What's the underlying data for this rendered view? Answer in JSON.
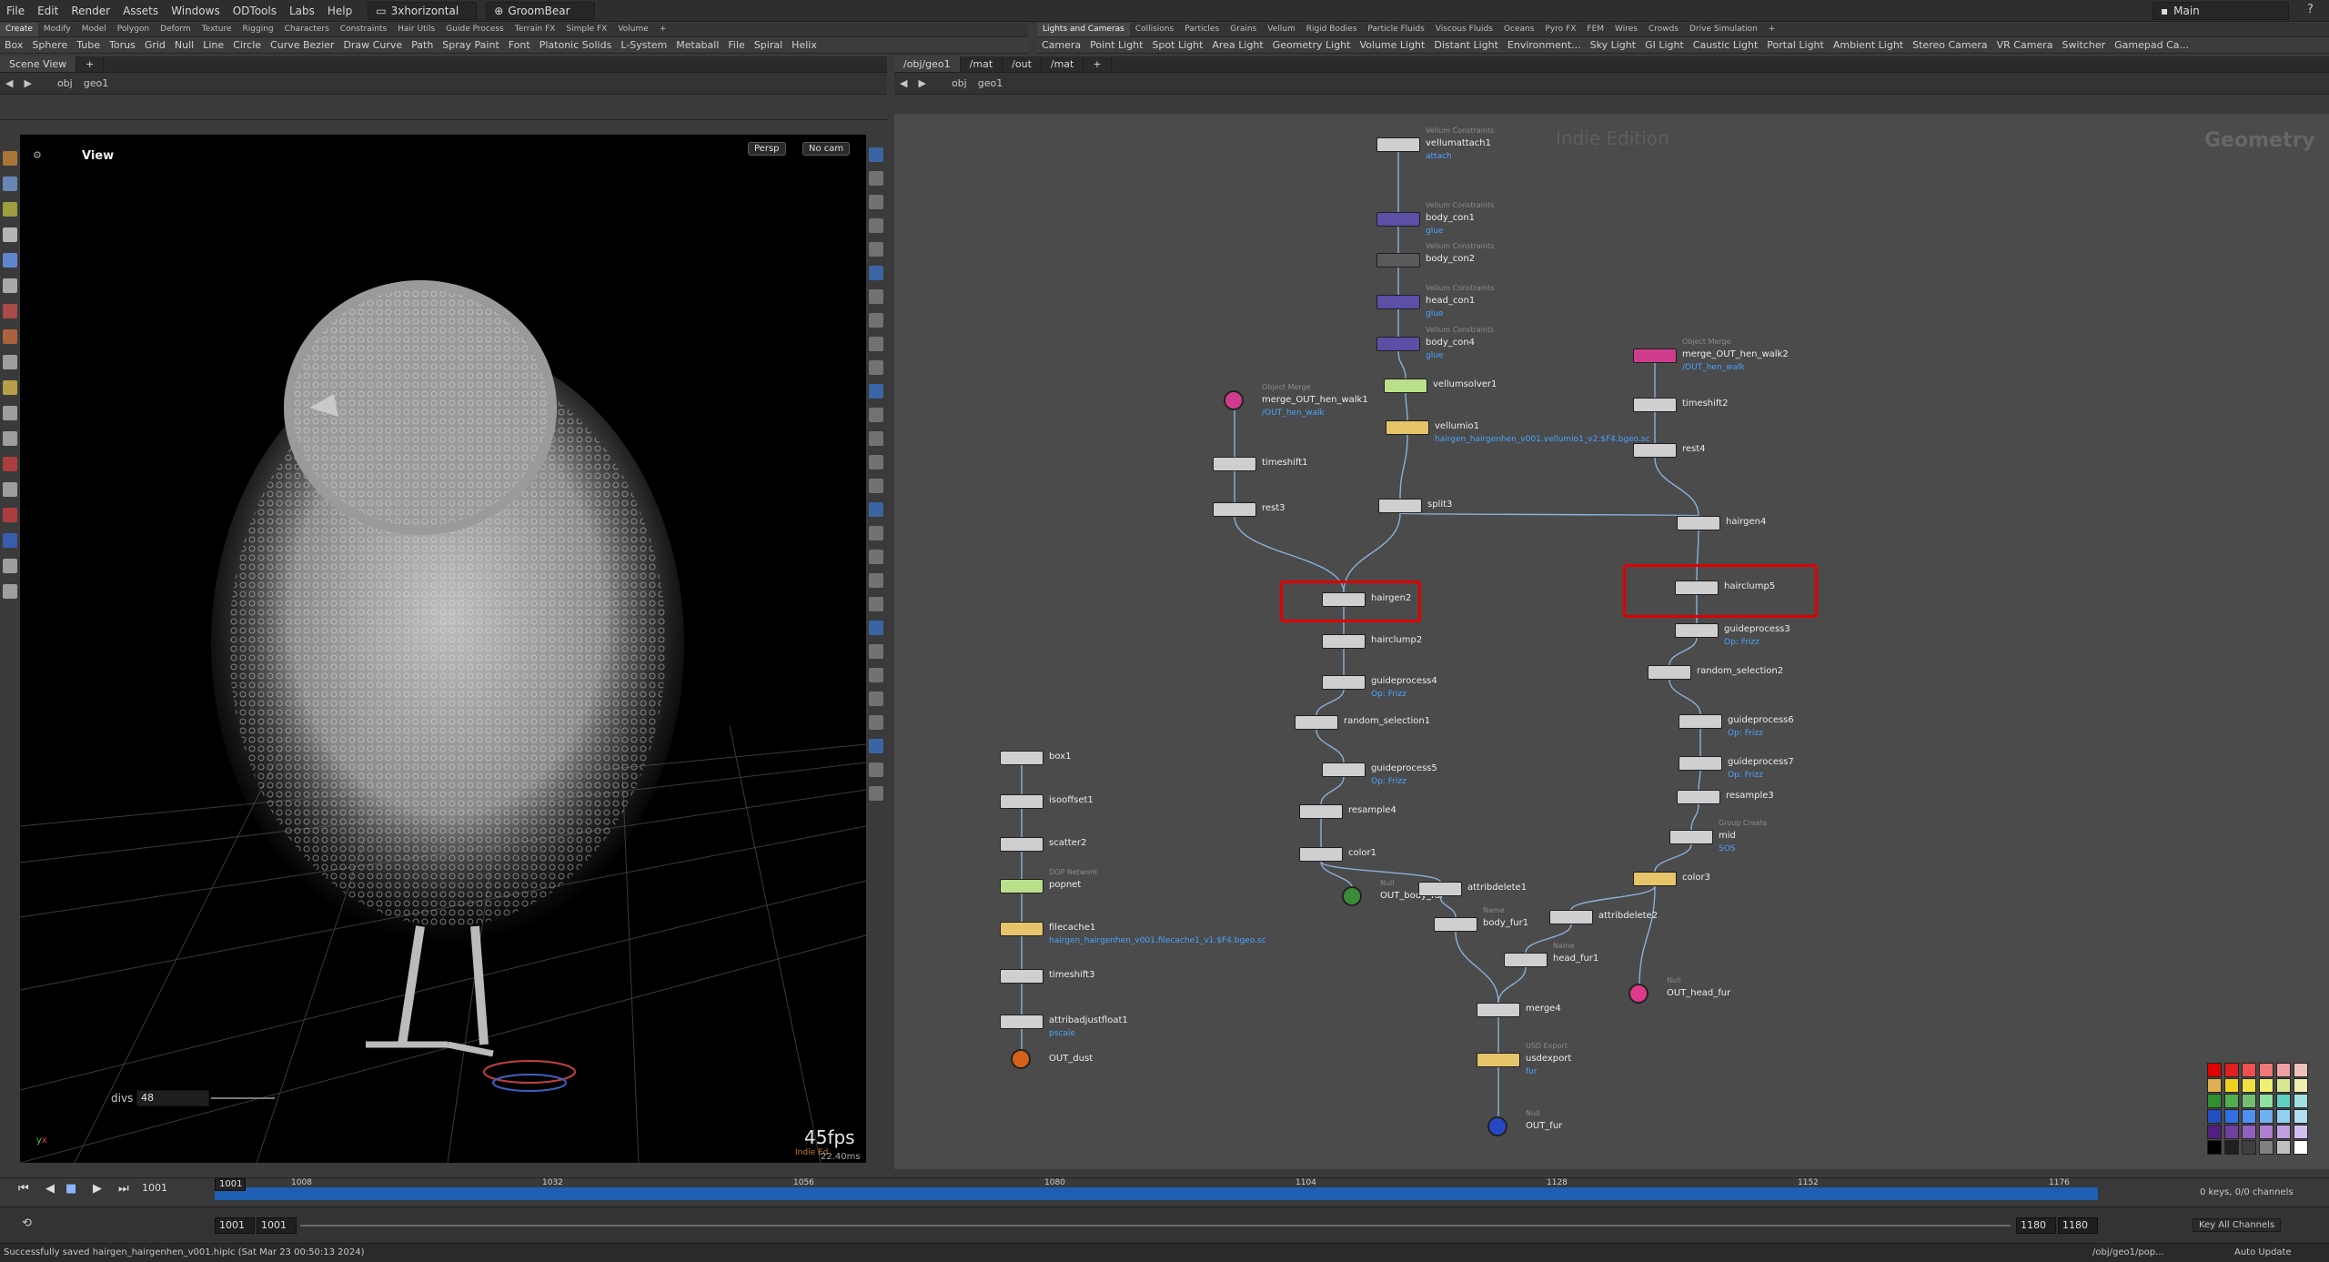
{
  "menubar": {
    "items": [
      "File",
      "Edit",
      "Render",
      "Assets",
      "Windows",
      "ODTools",
      "Labs",
      "Help"
    ],
    "desktop": "3xhorizontal",
    "project": "GroomBear",
    "main_desktop": "Main"
  },
  "shelf_left": {
    "tabs": [
      "Create",
      "Modify",
      "Model",
      "Polygon",
      "Deform",
      "Texture",
      "Rigging",
      "Characters",
      "Constraints",
      "Hair Utils",
      "Guide Process",
      "Terrain FX",
      "Simple FX",
      "Volume"
    ],
    "tools": [
      "Box",
      "Sphere",
      "Tube",
      "Torus",
      "Grid",
      "Null",
      "Line",
      "Circle",
      "Curve Bezier",
      "Draw Curve",
      "Path",
      "Spray Paint",
      "Font",
      "Platonic Solids",
      "L-System",
      "Metaball",
      "File",
      "Spiral",
      "Helix"
    ]
  },
  "shelf_right": {
    "tabs": [
      "Lights and Cameras",
      "Collisions",
      "Particles",
      "Grains",
      "Vellum",
      "Rigid Bodies",
      "Particle Fluids",
      "Viscous Fluids",
      "Oceans",
      "Pyro FX",
      "FEM",
      "Wires",
      "Crowds",
      "Drive Simulation"
    ],
    "tools": [
      "Camera",
      "Point Light",
      "Spot Light",
      "Area Light",
      "Geometry Light",
      "Volume Light",
      "Distant Light",
      "Environment...",
      "Sky Light",
      "GI Light",
      "Caustic Light",
      "Portal Light",
      "Ambient Light",
      "Stereo Camera",
      "VR Camera",
      "Switcher",
      "Gamepad Ca..."
    ]
  },
  "left_pane": {
    "tab": "Scene View",
    "path": [
      "obj",
      "geo1"
    ],
    "view_label": "View",
    "persp_btn": "Persp",
    "cam_btn": "No cam",
    "divs_label": "divs",
    "divs_value": "48",
    "fps": "45fps",
    "ms": "22.40ms",
    "edition_watermark": "Indie Ed"
  },
  "right_pane": {
    "tabs": [
      "/obj/geo1",
      "/mat",
      "/out",
      "/mat"
    ],
    "path": [
      "obj",
      "geo1"
    ],
    "watermark": "Indie Edition",
    "context": "Geometry"
  },
  "nodes": [
    {
      "name": "vellumattach1",
      "type": "Vellum Constraints",
      "sub": "attach",
      "color": "#cfcfcf"
    },
    {
      "name": "body_con1",
      "type": "Vellum Constraints",
      "sub": "glue",
      "color": "#5b4fa6"
    },
    {
      "name": "body_con2",
      "type": "Vellum Constraints",
      "sub": "",
      "color": "#5a5a5a"
    },
    {
      "name": "head_con1",
      "type": "Vellum Constraints",
      "sub": "glue",
      "color": "#5b4fa6"
    },
    {
      "name": "body_con4",
      "type": "Vellum Constraints",
      "sub": "glue",
      "color": "#5b4fa6"
    },
    {
      "name": "vellumsolver1",
      "type": "",
      "sub": "",
      "color": "#b8e08a"
    },
    {
      "name": "vellumio1",
      "type": "",
      "sub": "hairgen_hairgenhen_v001.vellumio1_v2.$F4.bgeo.sc",
      "color": "#e5c46a"
    },
    {
      "name": "split3",
      "type": "",
      "sub": "",
      "color": "#cfcfcf"
    },
    {
      "name": "merge_OUT_hen_walk1",
      "type": "Object Merge",
      "sub": "/OUT_hen_walk",
      "color": "#d03c8c"
    },
    {
      "name": "timeshift1",
      "type": "",
      "sub": "",
      "color": "#cfcfcf"
    },
    {
      "name": "rest3",
      "type": "",
      "sub": "",
      "color": "#cfcfcf"
    },
    {
      "name": "hairgen2",
      "type": "",
      "sub": "",
      "color": "#cfcfcf"
    },
    {
      "name": "hairclump2",
      "type": "",
      "sub": "",
      "color": "#cfcfcf"
    },
    {
      "name": "guideprocess4",
      "type": "",
      "sub": "Op: Frizz",
      "color": "#cfcfcf"
    },
    {
      "name": "random_selection1",
      "type": "",
      "sub": "",
      "color": "#cfcfcf"
    },
    {
      "name": "guideprocess5",
      "type": "",
      "sub": "Op: Frizz",
      "color": "#cfcfcf"
    },
    {
      "name": "resample4",
      "type": "",
      "sub": "",
      "color": "#cfcfcf"
    },
    {
      "name": "color1",
      "type": "",
      "sub": "",
      "color": "#cfcfcf"
    },
    {
      "name": "OUT_body_fur",
      "type": "Null",
      "sub": "",
      "color": "#3a8a3a"
    },
    {
      "name": "attribdelete1",
      "type": "",
      "sub": "",
      "color": "#cfcfcf"
    },
    {
      "name": "body_fur1",
      "type": "Name",
      "sub": "",
      "color": "#cfcfcf"
    },
    {
      "name": "merge_OUT_hen_walk2",
      "type": "Object Merge",
      "sub": "/OUT_hen_walk",
      "color": "#d03c8c"
    },
    {
      "name": "timeshift2",
      "type": "",
      "sub": "",
      "color": "#cfcfcf"
    },
    {
      "name": "rest4",
      "type": "",
      "sub": "",
      "color": "#cfcfcf"
    },
    {
      "name": "hairgen4",
      "type": "",
      "sub": "",
      "color": "#cfcfcf"
    },
    {
      "name": "hairclump5",
      "type": "",
      "sub": "",
      "color": "#cfcfcf"
    },
    {
      "name": "guideprocess3",
      "type": "",
      "sub": "Op: Frizz",
      "color": "#cfcfcf"
    },
    {
      "name": "random_selection2",
      "type": "",
      "sub": "",
      "color": "#cfcfcf"
    },
    {
      "name": "guideprocess6",
      "type": "",
      "sub": "Op: Frizz",
      "color": "#cfcfcf"
    },
    {
      "name": "guideprocess7",
      "type": "",
      "sub": "Op: Frizz",
      "color": "#cfcfcf"
    },
    {
      "name": "resample3",
      "type": "",
      "sub": "",
      "color": "#cfcfcf"
    },
    {
      "name": "mid",
      "type": "Group Create",
      "sub": "SOS",
      "color": "#cfcfcf"
    },
    {
      "name": "color3",
      "type": "",
      "sub": "",
      "color": "#e5c46a"
    },
    {
      "name": "attribdelete2",
      "type": "",
      "sub": "",
      "color": "#cfcfcf"
    },
    {
      "name": "head_fur1",
      "type": "Name",
      "sub": "",
      "color": "#cfcfcf"
    },
    {
      "name": "OUT_head_fur",
      "type": "Null",
      "sub": "",
      "color": "#e0388a"
    },
    {
      "name": "merge4",
      "type": "",
      "sub": "",
      "color": "#cfcfcf"
    },
    {
      "name": "usdexport",
      "type": "USD Export",
      "sub": "fur",
      "color": "#e5c46a"
    },
    {
      "name": "OUT_fur",
      "type": "Null",
      "sub": "",
      "color": "#2448c4"
    },
    {
      "name": "box1",
      "type": "",
      "sub": "",
      "color": "#cfcfcf"
    },
    {
      "name": "isooffset1",
      "type": "",
      "sub": "",
      "color": "#cfcfcf"
    },
    {
      "name": "scatter2",
      "type": "",
      "sub": "",
      "color": "#cfcfcf"
    },
    {
      "name": "popnet",
      "type": "DOP Network",
      "sub": "",
      "color": "#b8e08a"
    },
    {
      "name": "filecache1",
      "type": "",
      "sub": "hairgen_hairgenhen_v001.filecache1_v1.$F4.bgeo.sc",
      "color": "#e5c46a"
    },
    {
      "name": "timeshift3",
      "type": "",
      "sub": "",
      "color": "#cfcfcf"
    },
    {
      "name": "attribadjustfloat1",
      "type": "",
      "sub": "pscale",
      "color": "#cfcfcf"
    },
    {
      "name": "OUT_dust",
      "type": "",
      "sub": "",
      "color": "#d4621a"
    }
  ],
  "timeline": {
    "ticks": [
      "1008",
      "1032",
      "1056",
      "1080",
      "1104",
      "1128",
      "1152",
      "1176"
    ],
    "current_frame": "1001",
    "frame_field": "1001",
    "start": "1001",
    "start2": "1001",
    "end": "1180",
    "end2": "1180",
    "keys_info": "0 keys, 0/0 channels",
    "key_all": "Key All Channels"
  },
  "status": {
    "message": "Successfully saved hairgen_hairgenhen_v001.hiplc (Sat Mar 23 00:50:13 2024)",
    "path": "/obj/geo1/pop...",
    "update_mode": "Auto Update"
  },
  "palette": [
    "#e00000",
    "#e02020",
    "#f05050",
    "#f07878",
    "#f0a0a0",
    "#f0c0c0",
    "#e0b050",
    "#f0d020",
    "#f0e040",
    "#f0f070",
    "#d8e890",
    "#f0f0b0",
    "#309030",
    "#50b050",
    "#70c070",
    "#90e0a0",
    "#60d0c0",
    "#a0e0e0",
    "#2050c0",
    "#3070e0",
    "#5090f0",
    "#70b0f0",
    "#90d0f0",
    "#b0e0f0",
    "#502080",
    "#7040a0",
    "#9060c0",
    "#b080d0",
    "#c0a0e0",
    "#d0c0f0",
    "#000000",
    "#202020",
    "#404040",
    "#808080",
    "#c0c0c0",
    "#ffffff"
  ]
}
